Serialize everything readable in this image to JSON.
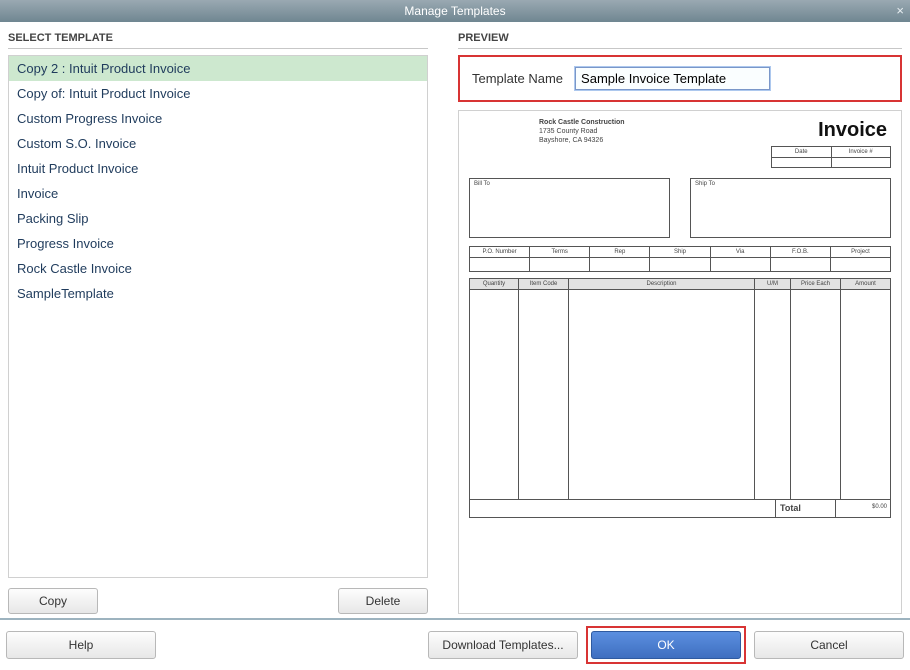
{
  "window": {
    "title": "Manage Templates"
  },
  "left": {
    "header": "SELECT TEMPLATE",
    "items": [
      "Copy 2 : Intuit Product Invoice",
      "Copy of: Intuit Product Invoice",
      "Custom Progress Invoice",
      "Custom S.O. Invoice",
      "Intuit Product Invoice",
      "Invoice",
      "Packing Slip",
      "Progress Invoice",
      "Rock Castle Invoice",
      "SampleTemplate"
    ],
    "selected_index": 0,
    "copy_label": "Copy",
    "delete_label": "Delete"
  },
  "right": {
    "header": "PREVIEW",
    "name_label": "Template Name",
    "name_value": "Sample Invoice Template"
  },
  "invoice": {
    "company": "Rock Castle Construction",
    "addr1": "1735 County Road",
    "addr2": "Bayshore, CA 94326",
    "title": "Invoice",
    "date_label": "Date",
    "invno_label": "Invoice #",
    "billto_label": "Bill To",
    "shipto_label": "Ship To",
    "row1": [
      "P.O. Number",
      "Terms",
      "Rep",
      "Ship",
      "Via",
      "F.O.B.",
      "Project"
    ],
    "cols": [
      "Quantity",
      "Item Code",
      "Description",
      "U/M",
      "Price Each",
      "Amount"
    ],
    "total_label": "Total",
    "total_amount": "$0.00"
  },
  "footer": {
    "help": "Help",
    "download": "Download Templates...",
    "ok": "OK",
    "cancel": "Cancel"
  }
}
